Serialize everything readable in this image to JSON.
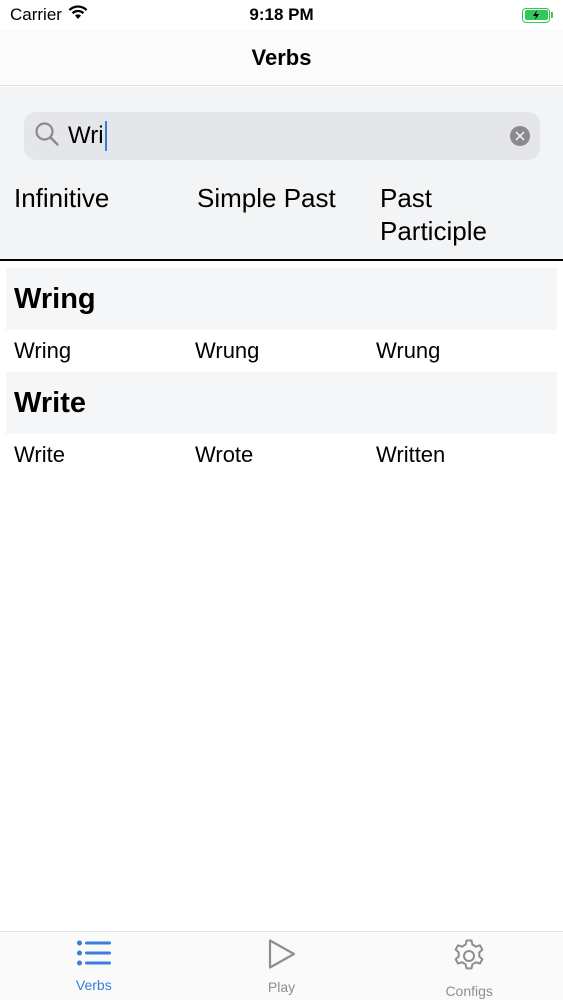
{
  "status_bar": {
    "carrier": "Carrier",
    "time": "9:18 PM"
  },
  "nav": {
    "title": "Verbs"
  },
  "search": {
    "value": "Wri"
  },
  "columns": [
    "Infinitive",
    "Simple Past",
    "Past\nParticiple"
  ],
  "sections": [
    {
      "header": "Wring",
      "row": [
        "Wring",
        "Wrung",
        "Wrung"
      ]
    },
    {
      "header": "Write",
      "row": [
        "Write",
        "Wrote",
        "Written"
      ]
    }
  ],
  "tabs": [
    {
      "label": "Verbs",
      "icon": "list-icon",
      "active": true
    },
    {
      "label": "Play",
      "icon": "play-icon",
      "active": false
    },
    {
      "label": "Configs",
      "icon": "gear-icon",
      "active": false
    }
  ],
  "colors": {
    "accent": "#3b7ddd",
    "inactive": "#8e8e93",
    "battery": "#34c759"
  }
}
